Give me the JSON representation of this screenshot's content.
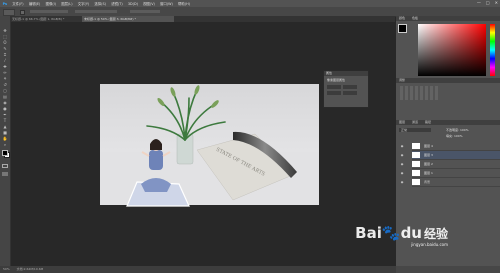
{
  "menu": [
    "文件(F)",
    "编辑(E)",
    "图像(I)",
    "图层(L)",
    "文字(Y)",
    "选择(S)",
    "滤镜(T)",
    "3D(D)",
    "视图(V)",
    "窗口(W)",
    "帮助(H)"
  ],
  "window_controls": {
    "minimize": "—",
    "maximize": "□",
    "close": "✕"
  },
  "tabs": [
    {
      "label": "无标题-1 @ 66.7% (图层 1, RGB/8) *",
      "active": false
    },
    {
      "label": "未标题-1 @ 50% (图层 3, RGB/8#) *",
      "active": true
    }
  ],
  "tools": [
    "move-tool",
    "marquee-tool",
    "lasso-tool",
    "quick-select-tool",
    "crop-tool",
    "eyedropper-tool",
    "healing-brush-tool",
    "brush-tool",
    "clone-stamp-tool",
    "history-brush-tool",
    "eraser-tool",
    "gradient-tool",
    "blur-tool",
    "dodge-tool",
    "pen-tool",
    "type-tool",
    "path-select-tool",
    "shape-tool",
    "hand-tool",
    "zoom-tool"
  ],
  "tool_glyphs": [
    "✥",
    "⬚",
    "ʘ",
    "✎",
    "⌗",
    "⁄",
    "✚",
    "✏",
    "⚘",
    "↺",
    "◻",
    "▤",
    "◉",
    "●",
    "✒",
    "T",
    "▲",
    "■",
    "✋",
    "⌕"
  ],
  "colors": {
    "foreground": "#000000",
    "background": "#ffffff",
    "accent": "#31a8ff",
    "color_field_red": "#ff0000"
  },
  "status": {
    "zoom": "50%",
    "doc": "文档:2.64M/10.6M"
  },
  "panels": {
    "color_tab": "颜色",
    "swatches_tab": "色板",
    "adjustments_tab": "调整",
    "layers_tab": "图层",
    "channels_tab": "通道",
    "paths_tab": "路径",
    "properties_title": "属性",
    "properties_subtitle": "像素图层属性",
    "opacity_label": "不透明度:",
    "opacity_value": "100%",
    "fill_label": "填充:",
    "fill_value": "100%",
    "blend_mode": "正常"
  },
  "layers": [
    {
      "name": "图层 4",
      "visible": true
    },
    {
      "name": "图层 3",
      "visible": true
    },
    {
      "name": "图层 2",
      "visible": true
    },
    {
      "name": "图层 1",
      "visible": true
    },
    {
      "name": "背景",
      "visible": true
    }
  ],
  "canvas": {
    "open_book_text": "STATE OF THE ARTS"
  },
  "watermark": {
    "brand": "Bai",
    "brand2": "du",
    "brand3": "经验",
    "url": "jingyan.baidu.com"
  }
}
